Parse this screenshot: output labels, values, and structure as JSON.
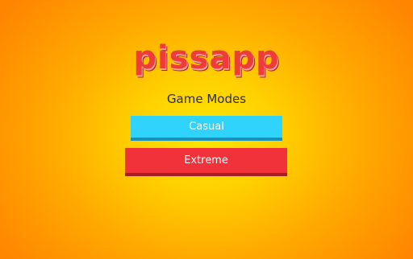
{
  "game": {
    "logo_text": "pissapp"
  },
  "menu": {
    "title": "Game Modes",
    "buttons": [
      {
        "label": "Casual",
        "color": "#2fd3fb"
      },
      {
        "label": "Extreme",
        "color": "#f2323a"
      }
    ]
  },
  "theme": {
    "background_center": "#ffe600",
    "background_edge": "#ff8500",
    "logo_color": "#ef3b3b",
    "title_color": "#2e2c45"
  }
}
